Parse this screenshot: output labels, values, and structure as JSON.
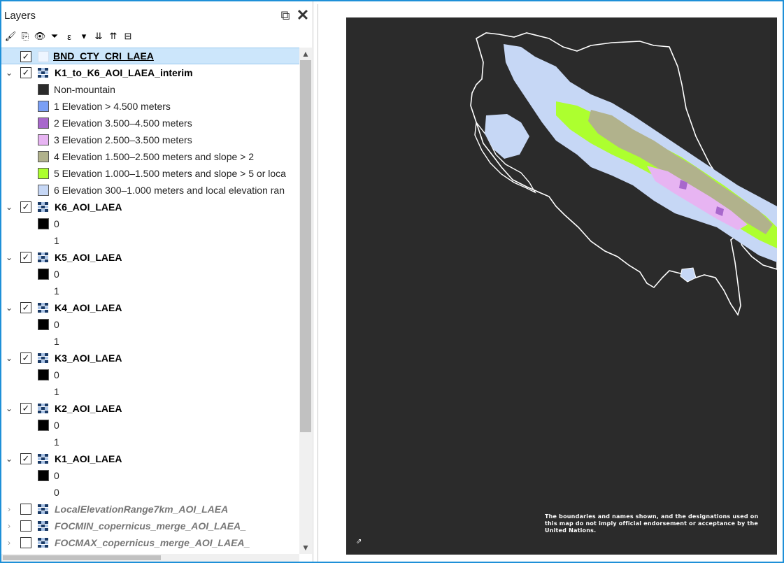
{
  "panel": {
    "title": "Layers",
    "float_glyph": "⧉",
    "close_glyph": "✕"
  },
  "toolbar": [
    {
      "name": "style-manager-icon",
      "glyph": "🖌"
    },
    {
      "name": "add-group-icon",
      "glyph": "⎘"
    },
    {
      "name": "visibility-icon",
      "glyph": "👁"
    },
    {
      "name": "filter-legend-icon",
      "glyph": "⏷"
    },
    {
      "name": "filter-expression-icon",
      "glyph": "ε"
    },
    {
      "name": "dropdown-arrow-icon",
      "glyph": "▾"
    },
    {
      "name": "expand-all-icon",
      "glyph": "⇊"
    },
    {
      "name": "collapse-all-icon",
      "glyph": "⇈"
    },
    {
      "name": "remove-layer-icon",
      "glyph": "⊟"
    }
  ],
  "tree": {
    "vector_layer": {
      "name": "BND_CTY_CRI_LAEA",
      "checked": "✓"
    },
    "interim_layer": {
      "name": "K1_to_K6_AOI_LAEA_interim",
      "checked": "✓",
      "legend": [
        {
          "label": "Non-mountain",
          "color": "#2b2b2b"
        },
        {
          "label": "1 Elevation > 4.500 meters",
          "color": "#7a9ff5"
        },
        {
          "label": "2 Elevation 3.500–4.500 meters",
          "color": "#a868cc"
        },
        {
          "label": "3 Elevation 2.500–3.500 meters",
          "color": "#e7b4f2"
        },
        {
          "label": "4 Elevation 1.500–2.500 meters and slope > 2",
          "color": "#b1b28c"
        },
        {
          "label": "5 Elevation 1.000–1.500 meters and slope > 5 or loca",
          "color": "#adff2f"
        },
        {
          "label": "6 Elevation 300–1.000 meters and local elevation ran",
          "color": "#c6d7f5"
        }
      ]
    },
    "k_layers": [
      {
        "name": "K6_AOI_LAEA",
        "checked": "✓",
        "val0": "0",
        "val1": "1"
      },
      {
        "name": "K5_AOI_LAEA",
        "checked": "✓",
        "val0": "0",
        "val1": "1"
      },
      {
        "name": "K4_AOI_LAEA",
        "checked": "✓",
        "val0": "0",
        "val1": "1"
      },
      {
        "name": "K3_AOI_LAEA",
        "checked": "✓",
        "val0": "0",
        "val1": "1"
      },
      {
        "name": "K2_AOI_LAEA",
        "checked": "✓",
        "val0": "0",
        "val1": "1"
      },
      {
        "name": "K1_AOI_LAEA",
        "checked": "✓",
        "val0": "0",
        "val1": "0"
      }
    ],
    "off_layers": [
      {
        "name": "LocalElevationRange7km_AOI_LAEA"
      },
      {
        "name": "FOCMIN_copernicus_merge_AOI_LAEA_"
      },
      {
        "name": "FOCMAX_copernicus_merge_AOI_LAEA_"
      }
    ],
    "expand_glyph": "⌄",
    "collapse_glyph": "›"
  },
  "map": {
    "disclaimer": "The boundaries and names shown, and the designations used on this map do not imply official endorsement or acceptance by the United Nations.",
    "background_color": "#2b2b2b",
    "boundary_color": "#ffffff"
  }
}
